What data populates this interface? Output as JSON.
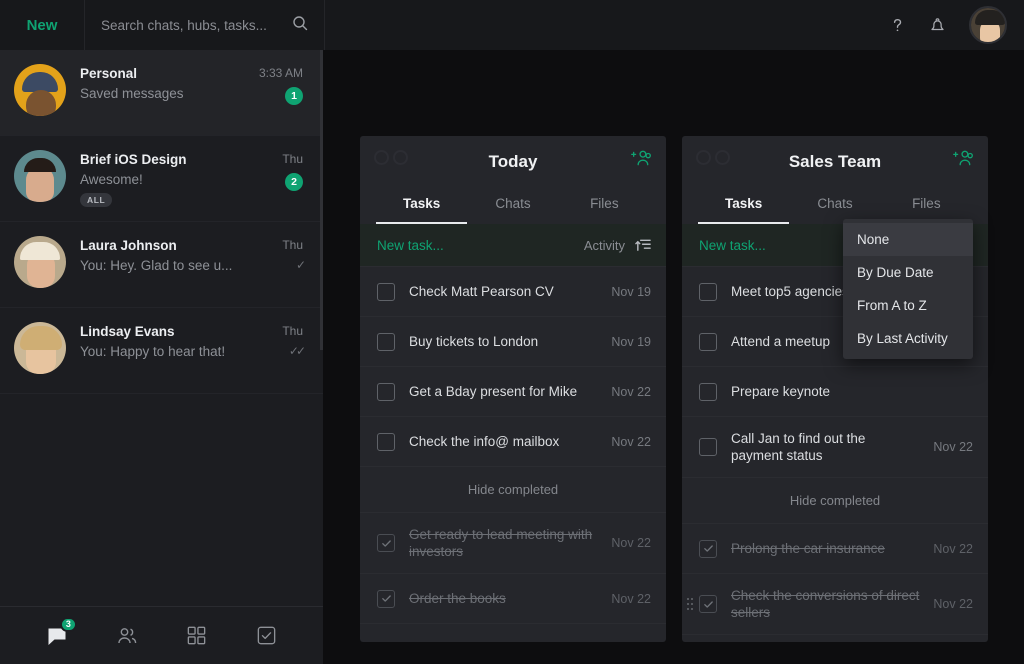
{
  "topbar": {
    "new_label": "New",
    "search_placeholder": "Search chats, hubs, tasks...",
    "search_value": "",
    "search_icon": "search-icon",
    "help_icon": "question-mark-icon",
    "bell_icon": "notification-bell-icon",
    "avatar_icon": "user-avatar"
  },
  "sidebar": {
    "chats": [
      {
        "name": "Personal",
        "snippet": "Saved messages",
        "time": "3:33 AM",
        "badge": "1",
        "tag": "",
        "ticks": "",
        "active": true
      },
      {
        "name": "Brief iOS Design",
        "snippet": "Awesome!",
        "time": "Thu",
        "badge": "2",
        "tag": "ALL",
        "ticks": "",
        "active": false
      },
      {
        "name": "Laura Johnson",
        "snippet": "You: Hey. Glad to see u...",
        "time": "Thu",
        "badge": "",
        "tag": "",
        "ticks": "✓",
        "active": false
      },
      {
        "name": "Lindsay Evans",
        "snippet": "You: Happy to hear that!",
        "time": "Thu",
        "badge": "",
        "tag": "",
        "ticks": "✓✓",
        "active": false
      }
    ],
    "bottom_nav": [
      {
        "name": "chats",
        "icon": "chat-bubble-icon",
        "badge": "3",
        "active": true
      },
      {
        "name": "contacts",
        "icon": "people-icon",
        "badge": "",
        "active": false
      },
      {
        "name": "apps",
        "icon": "grid-apps-icon",
        "badge": "",
        "active": false
      },
      {
        "name": "tasks",
        "icon": "checkbox-icon",
        "badge": "",
        "active": false
      }
    ]
  },
  "columns": [
    {
      "title": "Today",
      "add_user_icon": "add-user-icon",
      "tabs": [
        {
          "label": "Tasks",
          "active": true
        },
        {
          "label": "Chats",
          "active": false
        },
        {
          "label": "Files",
          "active": false
        }
      ],
      "new_task_label": "New task...",
      "sort_label": "Activity",
      "sort_icon": "sort-ascending-icon",
      "tasks": [
        {
          "text": "Check Matt Pearson CV",
          "date": "Nov 19",
          "done": false,
          "grip": false
        },
        {
          "text": "Buy tickets to London",
          "date": "Nov 19",
          "done": false,
          "grip": false
        },
        {
          "text": "Get a Bday present for Mike",
          "date": "Nov 22",
          "done": false,
          "grip": false
        },
        {
          "text": "Check the info@ mailbox",
          "date": "Nov 22",
          "done": false,
          "grip": false
        }
      ],
      "hide_completed_label": "Hide completed",
      "completed": [
        {
          "text": "Get ready to lead meeting with investors",
          "date": "Nov 22",
          "done": true,
          "grip": false
        },
        {
          "text": "Order the books",
          "date": "Nov 22",
          "done": true,
          "grip": false
        }
      ]
    },
    {
      "title": "Sales Team",
      "add_user_icon": "add-user-icon",
      "tabs": [
        {
          "label": "Tasks",
          "active": true
        },
        {
          "label": "Chats",
          "active": false
        },
        {
          "label": "Files",
          "active": false
        }
      ],
      "new_task_label": "New task...",
      "sort_label": "",
      "sort_icon": "sort-descending-icon",
      "tasks": [
        {
          "text": "Meet top5 agencies",
          "date": "",
          "done": false,
          "grip": false
        },
        {
          "text": "Attend a meetup",
          "date": "",
          "done": false,
          "grip": false
        },
        {
          "text": "Prepare keynote",
          "date": "",
          "done": false,
          "grip": false
        },
        {
          "text": "Call Jan to find out the payment status",
          "date": "Nov 22",
          "done": false,
          "grip": false
        }
      ],
      "hide_completed_label": "Hide completed",
      "completed": [
        {
          "text": "Prolong the car insurance",
          "date": "Nov 22",
          "done": true,
          "grip": false
        },
        {
          "text": "Check the conversions of direct sellers",
          "date": "Nov 22",
          "done": true,
          "grip": true
        }
      ]
    }
  ],
  "dropdown": {
    "items": [
      {
        "label": "None",
        "highlighted": true
      },
      {
        "label": "By Due Date",
        "highlighted": false
      },
      {
        "label": "From A to Z",
        "highlighted": false
      },
      {
        "label": "By Last Activity",
        "highlighted": false
      }
    ]
  },
  "colors": {
    "accent": "#0fa372",
    "background": "#0d0d0f",
    "panel": "#25262b",
    "sidebar": "#1c1d21",
    "topbar": "#17181b",
    "menu": "#303136"
  }
}
